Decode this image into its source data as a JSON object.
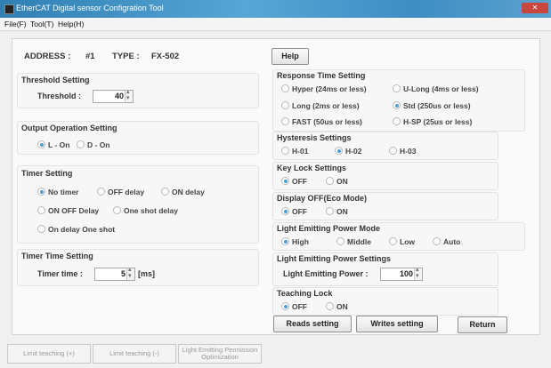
{
  "window": {
    "title": "EtherCAT Digital sensor Configration Tool"
  },
  "menu": {
    "items": [
      "File(F)",
      "Tool(T)",
      "Help(H)"
    ]
  },
  "header": {
    "address_label": "ADDRESS :",
    "address_value": "#1",
    "type_label": "TYPE :",
    "type_value": "FX-502"
  },
  "threshold": {
    "title": "Threshold Setting",
    "label": "Threshold :",
    "value": "40"
  },
  "output_operation": {
    "title": "Output Operation Setting",
    "options": [
      "L - On",
      "D - On"
    ],
    "selected": "L - On"
  },
  "timer": {
    "title": "Timer Setting",
    "options": [
      "No timer",
      "OFF delay",
      "ON delay",
      "ON OFF Delay",
      "One shot delay",
      "On delay One shot"
    ],
    "selected": "No timer"
  },
  "timer_time": {
    "title": "Timer Time Setting",
    "label": "Timer time :",
    "value": "5",
    "unit": "[ms]"
  },
  "help_button": "Help",
  "response_time": {
    "title": "Response Time Setting",
    "options": [
      "Hyper (24ms or less)",
      "U-Long (4ms or less)",
      "Long (2ms or less)",
      "Std (250us or less)",
      "FAST (50us or less)",
      "H-SP (25us or less)"
    ],
    "selected": "Std (250us or less)"
  },
  "hysteresis": {
    "title": "Hysteresis Settings",
    "options": [
      "H-01",
      "H-02",
      "H-03"
    ],
    "selected": "H-02"
  },
  "key_lock": {
    "title": "Key Lock Settings",
    "options": [
      "OFF",
      "ON"
    ],
    "selected": "OFF"
  },
  "display_off": {
    "title": "Display OFF(Eco Mode)",
    "options": [
      "OFF",
      "ON"
    ],
    "selected": "OFF"
  },
  "emit_mode": {
    "title": "Light Emitting Power Mode",
    "options": [
      "High",
      "Middle",
      "Low",
      "Auto"
    ],
    "selected": "High"
  },
  "emit_power": {
    "title": "Light Emitting Power Settings",
    "label": "Light Emitting Power :",
    "value": "100"
  },
  "teaching_lock": {
    "title": "Teaching Lock",
    "options": [
      "OFF",
      "ON"
    ],
    "selected": "OFF"
  },
  "actions": {
    "read": "Reads setting",
    "write": "Writes setting",
    "return": "Return"
  },
  "footer": {
    "limit_plus": "Limit teaching (+)",
    "limit_minus": "Limit teaching (-)",
    "optimization_line1": "Light Emitting Permission",
    "optimization_line2": "Optimization"
  },
  "colors": {
    "titlebar": "#3f8dc3",
    "radio_selected": "#4a9ed8",
    "close_button": "#c9463d"
  }
}
